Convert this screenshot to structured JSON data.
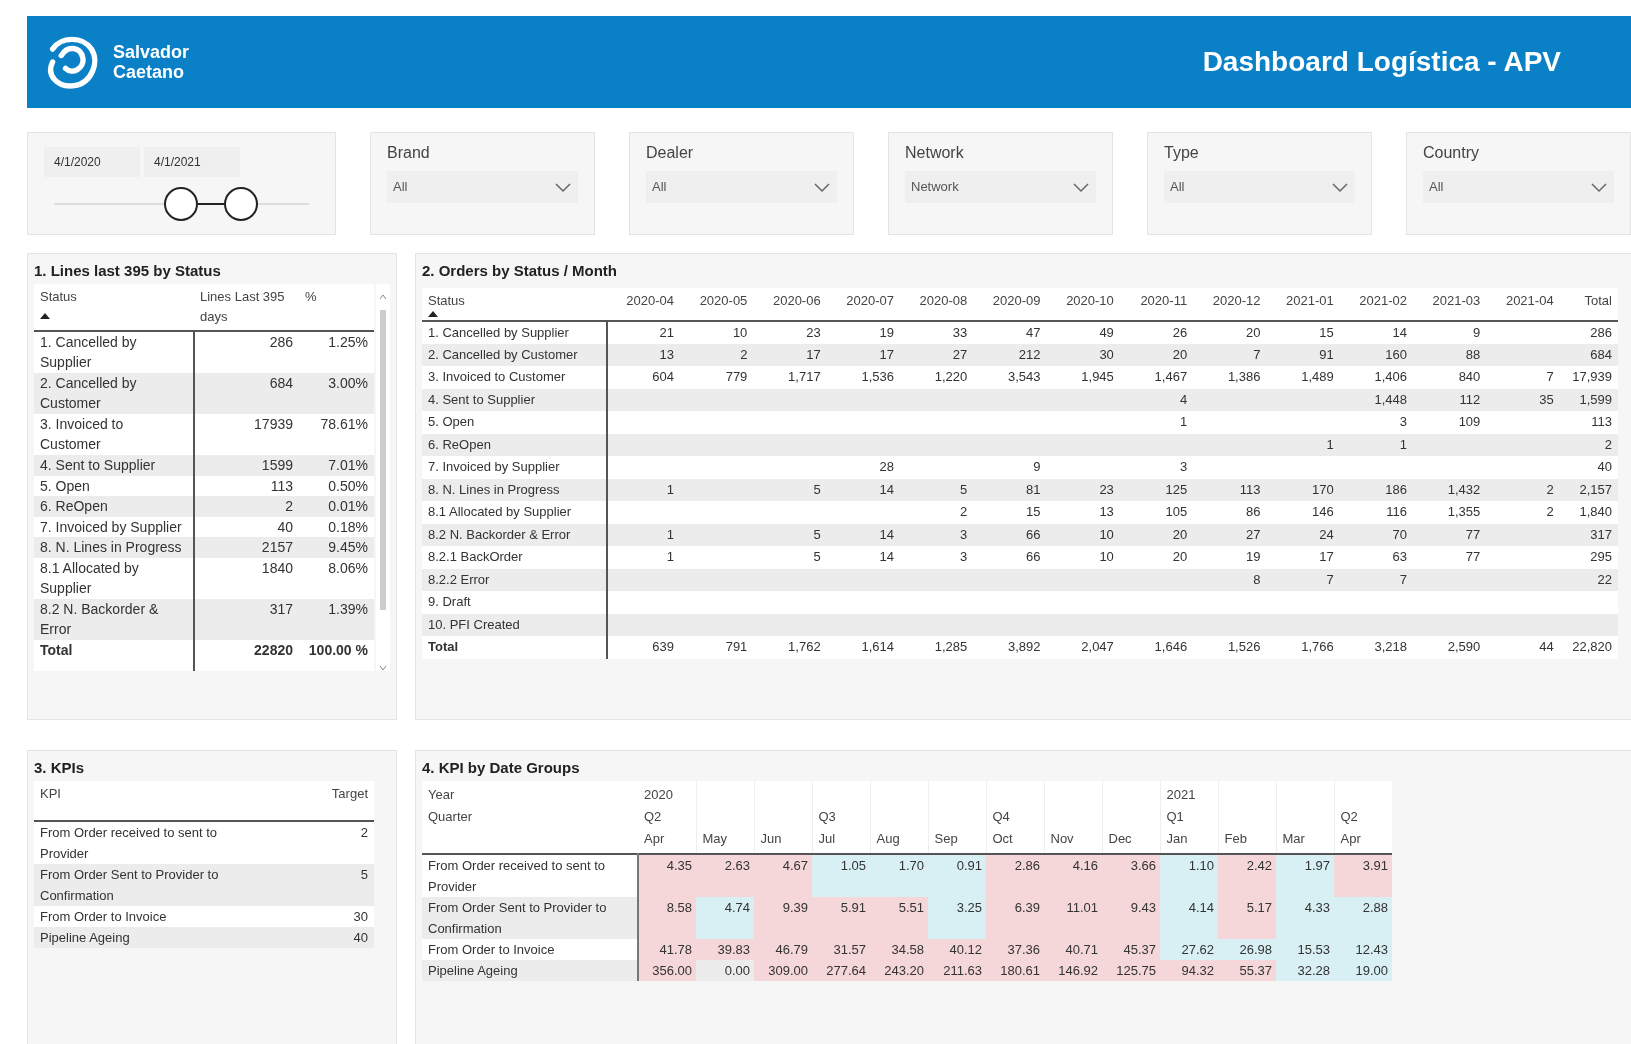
{
  "header": {
    "logo_line1": "Salvador",
    "logo_line2": "Caetano",
    "title": "Dashboard Logística - APV"
  },
  "date_slicer": {
    "start": "4/1/2020",
    "end": "4/1/2021"
  },
  "filters": [
    {
      "label": "Brand",
      "value": "All"
    },
    {
      "label": "Dealer",
      "value": "All"
    },
    {
      "label": "Network",
      "value": "Network"
    },
    {
      "label": "Type",
      "value": "All"
    },
    {
      "label": "Country",
      "value": "All"
    }
  ],
  "lines_by_status": {
    "title": "1. Lines last 395 by Status",
    "columns": [
      "Status",
      "Lines Last 395 days",
      "%"
    ],
    "rows": [
      [
        "1. Cancelled by Supplier",
        "286",
        "1.25%"
      ],
      [
        "2. Cancelled by Customer",
        "684",
        "3.00%"
      ],
      [
        "3. Invoiced to Customer",
        "17939",
        "78.61%"
      ],
      [
        "4. Sent to Supplier",
        "1599",
        "7.01%"
      ],
      [
        "5. Open",
        "113",
        "0.50%"
      ],
      [
        "6. ReOpen",
        "2",
        "0.01%"
      ],
      [
        "7. Invoiced by Supplier",
        "40",
        "0.18%"
      ],
      [
        "8. N. Lines in Progress",
        "2157",
        "9.45%"
      ],
      [
        "8.1 Allocated by Supplier",
        "1840",
        "8.06%"
      ],
      [
        "8.2 N. Backorder & Error",
        "317",
        "1.39%"
      ]
    ],
    "total": [
      "Total",
      "22820",
      "100.00 %"
    ]
  },
  "orders_by_month": {
    "title": "2. Orders by Status / Month",
    "columns": [
      "Status",
      "2020-04",
      "2020-05",
      "2020-06",
      "2020-07",
      "2020-08",
      "2020-09",
      "2020-10",
      "2020-11",
      "2020-12",
      "2021-01",
      "2021-02",
      "2021-03",
      "2021-04",
      "Total"
    ],
    "rows": [
      [
        "1. Cancelled by Supplier",
        "21",
        "10",
        "23",
        "19",
        "33",
        "47",
        "49",
        "26",
        "20",
        "15",
        "14",
        "9",
        "",
        "286"
      ],
      [
        "2. Cancelled by Customer",
        "13",
        "2",
        "17",
        "17",
        "27",
        "212",
        "30",
        "20",
        "7",
        "91",
        "160",
        "88",
        "",
        "684"
      ],
      [
        "3. Invoiced to Customer",
        "604",
        "779",
        "1,717",
        "1,536",
        "1,220",
        "3,543",
        "1,945",
        "1,467",
        "1,386",
        "1,489",
        "1,406",
        "840",
        "7",
        "17,939"
      ],
      [
        "4. Sent to Supplier",
        "",
        "",
        "",
        "",
        "",
        "",
        "",
        "4",
        "",
        "",
        "1,448",
        "112",
        "35",
        "1,599"
      ],
      [
        "5. Open",
        "",
        "",
        "",
        "",
        "",
        "",
        "",
        "1",
        "",
        "",
        "3",
        "109",
        "",
        "113"
      ],
      [
        "6. ReOpen",
        "",
        "",
        "",
        "",
        "",
        "",
        "",
        "",
        "",
        "1",
        "1",
        "",
        "",
        "2"
      ],
      [
        "7. Invoiced by Supplier",
        "",
        "",
        "",
        "28",
        "",
        "9",
        "",
        "3",
        "",
        "",
        "",
        "",
        "",
        "40"
      ],
      [
        "8. N. Lines in Progress",
        "1",
        "",
        "5",
        "14",
        "5",
        "81",
        "23",
        "125",
        "113",
        "170",
        "186",
        "1,432",
        "2",
        "2,157"
      ],
      [
        "8.1 Allocated by Supplier",
        "",
        "",
        "",
        "",
        "2",
        "15",
        "13",
        "105",
        "86",
        "146",
        "116",
        "1,355",
        "2",
        "1,840"
      ],
      [
        "8.2 N. Backorder & Error",
        "1",
        "",
        "5",
        "14",
        "3",
        "66",
        "10",
        "20",
        "27",
        "24",
        "70",
        "77",
        "",
        "317"
      ],
      [
        "8.2.1 BackOrder",
        "1",
        "",
        "5",
        "14",
        "3",
        "66",
        "10",
        "20",
        "19",
        "17",
        "63",
        "77",
        "",
        "295"
      ],
      [
        "8.2.2 Error",
        "",
        "",
        "",
        "",
        "",
        "",
        "",
        "",
        "8",
        "7",
        "7",
        "",
        "",
        "22"
      ],
      [
        "9. Draft",
        "",
        "",
        "",
        "",
        "",
        "",
        "",
        "",
        "",
        "",
        "",
        "",
        "",
        ""
      ],
      [
        "10. PFI Created",
        "",
        "",
        "",
        "",
        "",
        "",
        "",
        "",
        "",
        "",
        "",
        "",
        "",
        ""
      ]
    ],
    "total": [
      "Total",
      "639",
      "791",
      "1,762",
      "1,614",
      "1,285",
      "3,892",
      "2,047",
      "1,646",
      "1,526",
      "1,766",
      "3,218",
      "2,590",
      "44",
      "22,820"
    ]
  },
  "kpis": {
    "title": "3. KPIs",
    "columns": [
      "KPI",
      "Target"
    ],
    "rows": [
      [
        "From Order received to sent to Provider",
        "2"
      ],
      [
        "From Order Sent to Provider to Confirmation",
        "5"
      ],
      [
        "From Order to Invoice",
        "30"
      ],
      [
        "Pipeline Ageing",
        "40"
      ]
    ]
  },
  "kpi_by_date": {
    "title": "4. KPI by Date Groups",
    "year_label": "Year",
    "quarter_label": "Quarter",
    "columns": [
      {
        "year": "2020",
        "quarter": "Q2",
        "month": "Apr"
      },
      {
        "month": "May"
      },
      {
        "month": "Jun"
      },
      {
        "quarter": "Q3",
        "month": "Jul"
      },
      {
        "month": "Aug"
      },
      {
        "month": "Sep"
      },
      {
        "quarter": "Q4",
        "month": "Oct"
      },
      {
        "month": "Nov"
      },
      {
        "month": "Dec"
      },
      {
        "year": "2021",
        "quarter": "Q1",
        "month": "Jan"
      },
      {
        "month": "Feb"
      },
      {
        "month": "Mar"
      },
      {
        "quarter": "Q2",
        "month": "Apr"
      }
    ],
    "rows": [
      {
        "label": "From Order received to sent to Provider",
        "cells": [
          {
            "value": "4.35",
            "color": "#f5d7d9"
          },
          {
            "value": "2.63",
            "color": "#f5d7d9"
          },
          {
            "value": "4.67",
            "color": "#f5d7d9"
          },
          {
            "value": "1.05",
            "color": "#d8eff4"
          },
          {
            "value": "1.70",
            "color": "#d8eff4"
          },
          {
            "value": "0.91",
            "color": "#d8eff4"
          },
          {
            "value": "2.86",
            "color": "#f5d7d9"
          },
          {
            "value": "4.16",
            "color": "#f5d7d9"
          },
          {
            "value": "3.66",
            "color": "#f5d7d9"
          },
          {
            "value": "1.10",
            "color": "#d8eff4"
          },
          {
            "value": "2.42",
            "color": "#f5d7d9"
          },
          {
            "value": "1.97",
            "color": "#d8eff4"
          },
          {
            "value": "3.91",
            "color": "#f5d7d9"
          }
        ]
      },
      {
        "label": "From Order Sent to Provider to Confirmation",
        "cells": [
          {
            "value": "8.58",
            "color": "#f5d7d9"
          },
          {
            "value": "4.74",
            "color": "#d8eff4"
          },
          {
            "value": "9.39",
            "color": "#f5d7d9"
          },
          {
            "value": "5.91",
            "color": "#f5d7d9"
          },
          {
            "value": "5.51",
            "color": "#f5d7d9"
          },
          {
            "value": "3.25",
            "color": "#d8eff4"
          },
          {
            "value": "6.39",
            "color": "#f5d7d9"
          },
          {
            "value": "11.01",
            "color": "#f5d7d9"
          },
          {
            "value": "9.43",
            "color": "#f5d7d9"
          },
          {
            "value": "4.14",
            "color": "#d8eff4"
          },
          {
            "value": "5.17",
            "color": "#f5d7d9"
          },
          {
            "value": "4.33",
            "color": "#d8eff4"
          },
          {
            "value": "2.88",
            "color": "#d8eff4"
          }
        ]
      },
      {
        "label": "From Order to Invoice",
        "cells": [
          {
            "value": "41.78",
            "color": "#f5d7d9"
          },
          {
            "value": "39.83",
            "color": "#f5d7d9"
          },
          {
            "value": "46.79",
            "color": "#f5d7d9"
          },
          {
            "value": "31.57",
            "color": "#f5d7d9"
          },
          {
            "value": "34.58",
            "color": "#f5d7d9"
          },
          {
            "value": "40.12",
            "color": "#f5d7d9"
          },
          {
            "value": "37.36",
            "color": "#f5d7d9"
          },
          {
            "value": "40.71",
            "color": "#f5d7d9"
          },
          {
            "value": "45.37",
            "color": "#f5d7d9"
          },
          {
            "value": "27.62",
            "color": "#d8eff4"
          },
          {
            "value": "26.98",
            "color": "#d8eff4"
          },
          {
            "value": "15.53",
            "color": "#d8eff4"
          },
          {
            "value": "12.43",
            "color": "#d8eff4"
          }
        ]
      },
      {
        "label": "Pipeline Ageing",
        "cells": [
          {
            "value": "356.00",
            "color": "#f5d7d9"
          },
          {
            "value": "0.00"
          },
          {
            "value": "309.00",
            "color": "#f5d7d9"
          },
          {
            "value": "277.64",
            "color": "#f5d7d9"
          },
          {
            "value": "243.20",
            "color": "#f5d7d9"
          },
          {
            "value": "211.63",
            "color": "#f5d7d9"
          },
          {
            "value": "180.61",
            "color": "#f5d7d9"
          },
          {
            "value": "146.92",
            "color": "#f5d7d9"
          },
          {
            "value": "125.75",
            "color": "#f5d7d9"
          },
          {
            "value": "94.32",
            "color": "#f5d7d9"
          },
          {
            "value": "55.37",
            "color": "#f5d7d9"
          },
          {
            "value": "32.28",
            "color": "#d8eff4"
          },
          {
            "value": "19.00",
            "color": "#d8eff4"
          }
        ]
      }
    ]
  }
}
